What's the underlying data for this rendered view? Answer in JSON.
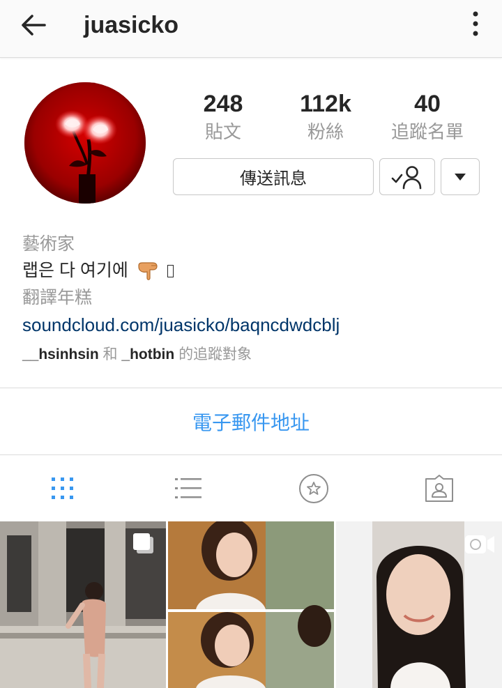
{
  "header": {
    "username": "juasicko",
    "back_icon": "arrow-left-icon",
    "more_icon": "more-vertical-icon"
  },
  "profile": {
    "stats": [
      {
        "value": "248",
        "label": "貼文"
      },
      {
        "value": "112k",
        "label": "粉絲"
      },
      {
        "value": "40",
        "label": "追蹤名單"
      }
    ],
    "message_button": "傳送訊息",
    "following_icon": "user-check-icon",
    "dropdown_icon": "caret-down-icon"
  },
  "bio": {
    "category": "藝術家",
    "text": "랩은 다 여기에",
    "text_line2": "翻譯年糕",
    "link": "soundcloud.com/juasicko/baqncdwdcblj",
    "followed_by": {
      "user1": "__hsinhsin",
      "and": "和",
      "user2": "_hotbin",
      "suffix": "的追蹤對象"
    }
  },
  "contact": {
    "email_label": "電子郵件地址"
  },
  "tabs": [
    {
      "icon": "grid-icon",
      "active": true
    },
    {
      "icon": "list-icon",
      "active": false
    },
    {
      "icon": "star-circle-icon",
      "active": false
    },
    {
      "icon": "tagged-user-icon",
      "active": false
    }
  ],
  "colors": {
    "link": "#003569",
    "accent": "#3897f0",
    "muted": "#999999",
    "text": "#262626"
  }
}
